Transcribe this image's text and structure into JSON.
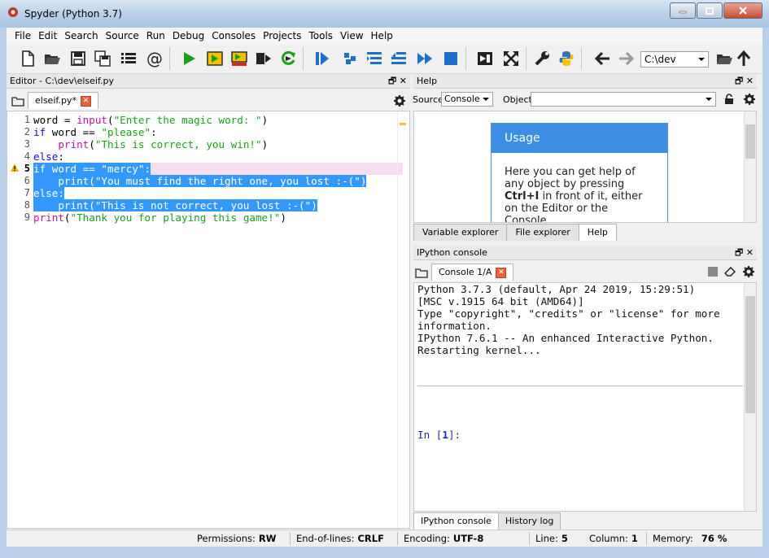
{
  "window": {
    "title": "Spyder (Python 3.7)"
  },
  "menu": [
    "File",
    "Edit",
    "Search",
    "Source",
    "Run",
    "Debug",
    "Consoles",
    "Projects",
    "Tools",
    "View",
    "Help"
  ],
  "toolbar": {
    "path": "C:\\dev"
  },
  "editor": {
    "pane_title": "Editor - C:\\dev\\elseif.py",
    "tab_label": "elseif.py*",
    "line_numbers": [
      "1",
      "2",
      "3",
      "4",
      "5",
      "6",
      "7",
      "8",
      "9"
    ],
    "lines": [
      [
        "word = ",
        "input",
        "(",
        "\"Enter the magic word: \"",
        ")"
      ],
      [
        "if",
        " word == ",
        "\"please\"",
        ":"
      ],
      [
        "    ",
        "print",
        "(",
        "\"This is correct, you win!\"",
        ")"
      ],
      [
        "else",
        ":"
      ],
      [
        "if word == \"mercy\":"
      ],
      [
        "    print(\"You must find the right one, you lost :-(\")"
      ],
      [
        "else:"
      ],
      [
        "    print(\"This is not correct, you lost :-(\")"
      ],
      [
        "print",
        "(",
        "\"Thank you for playing this game!\"",
        ")"
      ]
    ]
  },
  "help": {
    "pane_title": "Help",
    "source_label": "Source",
    "source_value": "Console",
    "object_label": "Object",
    "usage_title": "Usage",
    "usage_text_1": "Here you can get help of",
    "usage_text_2": "any object by pressing",
    "usage_text_3_bold": "Ctrl+I",
    "usage_text_3_rest": " in front of it, either",
    "usage_text_4": "on the Editor or the",
    "usage_text_5": "Console.",
    "tabs": [
      "Variable explorer",
      "File explorer",
      "Help"
    ]
  },
  "console": {
    "pane_title": "IPython console",
    "tab_label": "Console 1/A",
    "lines": [
      "Python 3.7.3 (default, Apr 24 2019, 15:29:51)",
      "[MSC v.1915 64 bit (AMD64)]",
      "Type \"copyright\", \"credits\" or \"license\" for more",
      "information.",
      "",
      "IPython 7.6.1 -- An enhanced Interactive Python.",
      "",
      "Restarting kernel...",
      "",
      "",
      "",
      "",
      ""
    ],
    "prompt_a": "In [",
    "prompt_n": "1",
    "prompt_b": "]:",
    "bottom_tabs": [
      "IPython console",
      "History log"
    ]
  },
  "status": {
    "permissions_label": "Permissions:",
    "permissions_value": "RW",
    "eol_label": "End-of-lines:",
    "eol_value": "CRLF",
    "encoding_label": "Encoding:",
    "encoding_value": "UTF-8",
    "line_label": "Line:",
    "line_value": "5",
    "column_label": "Column:",
    "column_value": "1",
    "memory_label": "Memory:",
    "memory_value": "76 %"
  },
  "colors": {
    "selection": "#3399ff",
    "keyword": "#1a0dbc",
    "string": "#1c9f1c",
    "builtin": "#c014a8",
    "usage_header": "#3b8ee4"
  }
}
